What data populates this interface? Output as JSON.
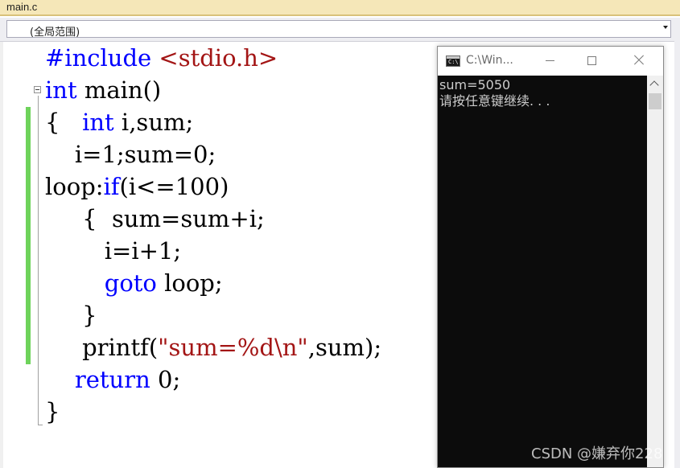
{
  "tab": {
    "file_name": "main.c"
  },
  "scope": {
    "selected": "(全局范围)"
  },
  "code": {
    "lines": [
      [
        {
          "t": "#include ",
          "c": "pp"
        },
        {
          "t": "<stdio.h>",
          "c": "inc"
        }
      ],
      [
        {
          "t": "int",
          "c": "kw"
        },
        {
          "t": " main()",
          "c": ""
        }
      ],
      [
        {
          "t": "{   ",
          "c": ""
        },
        {
          "t": "int",
          "c": "kw"
        },
        {
          "t": " i,sum;",
          "c": ""
        }
      ],
      [
        {
          "t": "    i=1;sum=0;",
          "c": ""
        }
      ],
      [
        {
          "t": "loop:",
          "c": ""
        },
        {
          "t": "if",
          "c": "kw"
        },
        {
          "t": "(i<=100)",
          "c": ""
        }
      ],
      [
        {
          "t": "     {  sum=sum+i;",
          "c": ""
        }
      ],
      [
        {
          "t": "        i=i+1;",
          "c": ""
        }
      ],
      [
        {
          "t": "        ",
          "c": ""
        },
        {
          "t": "goto",
          "c": "kw"
        },
        {
          "t": " loop;",
          "c": ""
        }
      ],
      [
        {
          "t": "     }",
          "c": ""
        }
      ],
      [
        {
          "t": "     printf(",
          "c": ""
        },
        {
          "t": "\"sum=%d\\n\"",
          "c": "str"
        },
        {
          "t": ",sum);",
          "c": ""
        }
      ],
      [
        {
          "t": "    ",
          "c": ""
        },
        {
          "t": "return",
          "c": "kw"
        },
        {
          "t": " 0;",
          "c": ""
        }
      ],
      [
        {
          "t": "}",
          "c": ""
        }
      ]
    ]
  },
  "console": {
    "title": "C:\\Win...",
    "output": "sum=5050\n请按任意键继续. . .",
    "icon": "console-app-icon",
    "controls": [
      "minimize-icon",
      "maximize-icon",
      "close-icon"
    ]
  },
  "watermark": {
    "text": "CSDN @嫌弃你228"
  }
}
